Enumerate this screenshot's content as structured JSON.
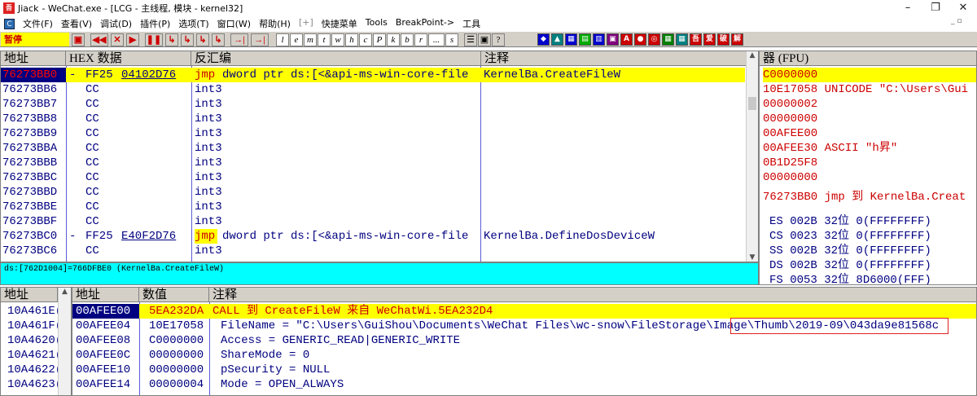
{
  "window": {
    "app_name": "Jiack",
    "title": "- WeChat.exe - [LCG - 主线程, 模块 - kernel32]",
    "icon_text": "吾爱",
    "minimize": "–",
    "restore": "❐",
    "close": "✕"
  },
  "menu": {
    "items": [
      "文件(F)",
      "查看(V)",
      "调试(D)",
      "插件(P)",
      "选项(T)",
      "窗口(W)",
      "帮助(H)",
      "[+]",
      "快捷菜单",
      "Tools",
      "BreakPoint->",
      "工具"
    ],
    "mdi_controls": "_ ▫"
  },
  "toolbar": {
    "status": "暂停",
    "buttons": [
      "▣",
      "◀◀",
      "✕",
      "▶",
      "❚❚",
      "↳",
      "↳",
      "↳",
      "↳",
      "→|",
      "→|"
    ],
    "letters": [
      "l",
      "e",
      "m",
      "t",
      "w",
      "h",
      "c",
      "P",
      "k",
      "b",
      "r",
      "...",
      "s"
    ],
    "extra": [
      "☰",
      "▣",
      "?"
    ],
    "color_buttons": [
      {
        "label": "◆",
        "color": "#0000cc"
      },
      {
        "label": "▲",
        "color": "#008080"
      },
      {
        "label": "▦",
        "color": "#0000cc"
      },
      {
        "label": "▤",
        "color": "#00aa00"
      },
      {
        "label": "▥",
        "color": "#0000cc"
      },
      {
        "label": "▣",
        "color": "#800080"
      },
      {
        "label": "A",
        "color": "#cc0000"
      },
      {
        "label": "●",
        "color": "#cc0000"
      },
      {
        "label": "◎",
        "color": "#cc0000"
      },
      {
        "label": "▦",
        "color": "#008000"
      },
      {
        "label": "▦",
        "color": "#008080"
      },
      {
        "label": "吾",
        "color": "#cc0000"
      },
      {
        "label": "爱",
        "color": "#cc0000"
      },
      {
        "label": "破",
        "color": "#cc0000"
      },
      {
        "label": "解",
        "color": "#cc0000"
      }
    ]
  },
  "disasm": {
    "headers": [
      "地址",
      "HEX 数据",
      "反汇编",
      "注释"
    ],
    "rows": [
      {
        "addr": "76273BB0",
        "mark": "-",
        "hex1": "FF25",
        "hex2": "04102D76",
        "mn": "jmp",
        "ops": "dword ptr ds:[<&api-ms-win-core-file",
        "comment": "KernelBa.CreateFileW",
        "selected": true
      },
      {
        "addr": "76273BB6",
        "mark": "",
        "hex1": "CC",
        "hex2": "",
        "mn": "int3",
        "ops": "",
        "comment": ""
      },
      {
        "addr": "76273BB7",
        "mark": "",
        "hex1": "CC",
        "hex2": "",
        "mn": "int3",
        "ops": "",
        "comment": ""
      },
      {
        "addr": "76273BB8",
        "mark": "",
        "hex1": "CC",
        "hex2": "",
        "mn": "int3",
        "ops": "",
        "comment": ""
      },
      {
        "addr": "76273BB9",
        "mark": "",
        "hex1": "CC",
        "hex2": "",
        "mn": "int3",
        "ops": "",
        "comment": ""
      },
      {
        "addr": "76273BBA",
        "mark": "",
        "hex1": "CC",
        "hex2": "",
        "mn": "int3",
        "ops": "",
        "comment": ""
      },
      {
        "addr": "76273BBB",
        "mark": "",
        "hex1": "CC",
        "hex2": "",
        "mn": "int3",
        "ops": "",
        "comment": ""
      },
      {
        "addr": "76273BBC",
        "mark": "",
        "hex1": "CC",
        "hex2": "",
        "mn": "int3",
        "ops": "",
        "comment": ""
      },
      {
        "addr": "76273BBD",
        "mark": "",
        "hex1": "CC",
        "hex2": "",
        "mn": "int3",
        "ops": "",
        "comment": ""
      },
      {
        "addr": "76273BBE",
        "mark": "",
        "hex1": "CC",
        "hex2": "",
        "mn": "int3",
        "ops": "",
        "comment": ""
      },
      {
        "addr": "76273BBF",
        "mark": "",
        "hex1": "CC",
        "hex2": "",
        "mn": "int3",
        "ops": "",
        "comment": ""
      },
      {
        "addr": "76273BC0",
        "mark": "-",
        "hex1": "FF25",
        "hex2": "E40F2D76",
        "mn": "jmp",
        "ops": "dword ptr ds:[<&api-ms-win-core-file",
        "comment": "KernelBa.DefineDosDeviceW"
      },
      {
        "addr": "76273BC6",
        "mark": "",
        "hex1": "CC",
        "hex2": "",
        "mn": "int3",
        "ops": "",
        "comment": ""
      }
    ]
  },
  "info_line": "ds:[762D1004]=766DFBE0 (KernelBa.CreateFileW)",
  "registers": {
    "header": "器 (FPU)",
    "lines": [
      {
        "text": "C0000000",
        "color": "#cc0000",
        "hl": true
      },
      {
        "text": "10E17058 UNICODE \"C:\\Users\\Gui",
        "color": "#cc0000"
      },
      {
        "text": "00000002",
        "color": "#cc0000"
      },
      {
        "text": "00000000",
        "color": "#cc0000"
      },
      {
        "text": "00AFEE00",
        "color": "#cc0000"
      },
      {
        "text": "00AFEE30 ASCII \"h昇\"",
        "color": "#cc0000"
      },
      {
        "text": "0B1D25F8",
        "color": "#cc0000"
      },
      {
        "text": "00000000",
        "color": "#cc0000"
      },
      {
        "text": "76273BB0 jmp 到 KernelBa.Creat",
        "color": "#cc0000"
      },
      {
        "text": "ES 002B 32位 0(FFFFFFFF)",
        "color": "#000080"
      },
      {
        "text": "CS 0023 32位 0(FFFFFFFF)",
        "color": "#000080"
      },
      {
        "text": "SS 002B 32位 0(FFFFFFFF)",
        "color": "#000080"
      },
      {
        "text": "DS 002B 32位 0(FFFFFFFF)",
        "color": "#000080"
      },
      {
        "text": "FS 0053 32位 8D6000(FFF)",
        "color": "#000080"
      }
    ]
  },
  "dump": {
    "header": "地址",
    "rows": [
      "10A461E(",
      "10A461F(",
      "10A4620(",
      "10A4621(",
      "10A4622(",
      "10A4623("
    ]
  },
  "stack": {
    "headers": [
      "地址",
      "数值",
      "注释"
    ],
    "rows": [
      {
        "addr": "00AFEE00",
        "val": "5EA232DA",
        "comment": "CALL 到 CreateFileW 来自 WeChatWi.5EA232D4",
        "selected": true
      },
      {
        "addr": "00AFEE04",
        "val": "10E17058",
        "comment": "FileName = \"C:\\Users\\GuiShou\\Documents\\WeChat Files\\wc-snow\\FileStorage\\Image\\Thumb\\2019-09\\043da9e81568c"
      },
      {
        "addr": "00AFEE08",
        "val": "C0000000",
        "comment": "Access = GENERIC_READ|GENERIC_WRITE"
      },
      {
        "addr": "00AFEE0C",
        "val": "00000000",
        "comment": "ShareMode = 0"
      },
      {
        "addr": "00AFEE10",
        "val": "00000000",
        "comment": "pSecurity = NULL"
      },
      {
        "addr": "00AFEE14",
        "val": "00000004",
        "comment": "Mode = OPEN_ALWAYS"
      }
    ]
  }
}
